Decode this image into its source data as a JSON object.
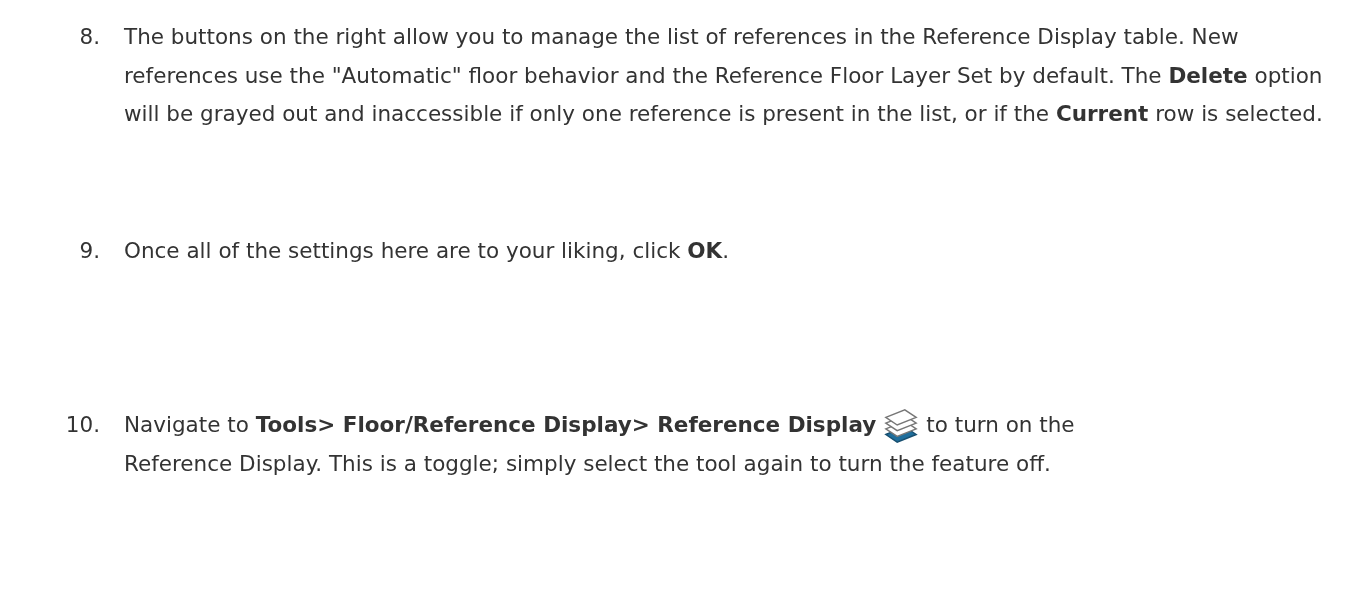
{
  "steps": [
    {
      "number": "8.",
      "text": "The buttons on the right allow you to manage the list of references in the Reference Display table. New references use the \"Automatic\" floor behavior and the Reference Floor Layer Set by default. The **Delete** option will be grayed out and inaccessible if only one reference is present in the list, or if the **Current** row is selected."
    },
    {
      "number": "9.",
      "text": "Once all of the settings here are to your liking, click **OK**."
    },
    {
      "number": "10.",
      "text": "Navigate to **Tools> Floor/Reference Display> Reference Display**",
      "text_after": "to turn on the",
      "text_continued": "Reference Display. This is a toggle; simply select the tool again to turn the feature off."
    }
  ]
}
